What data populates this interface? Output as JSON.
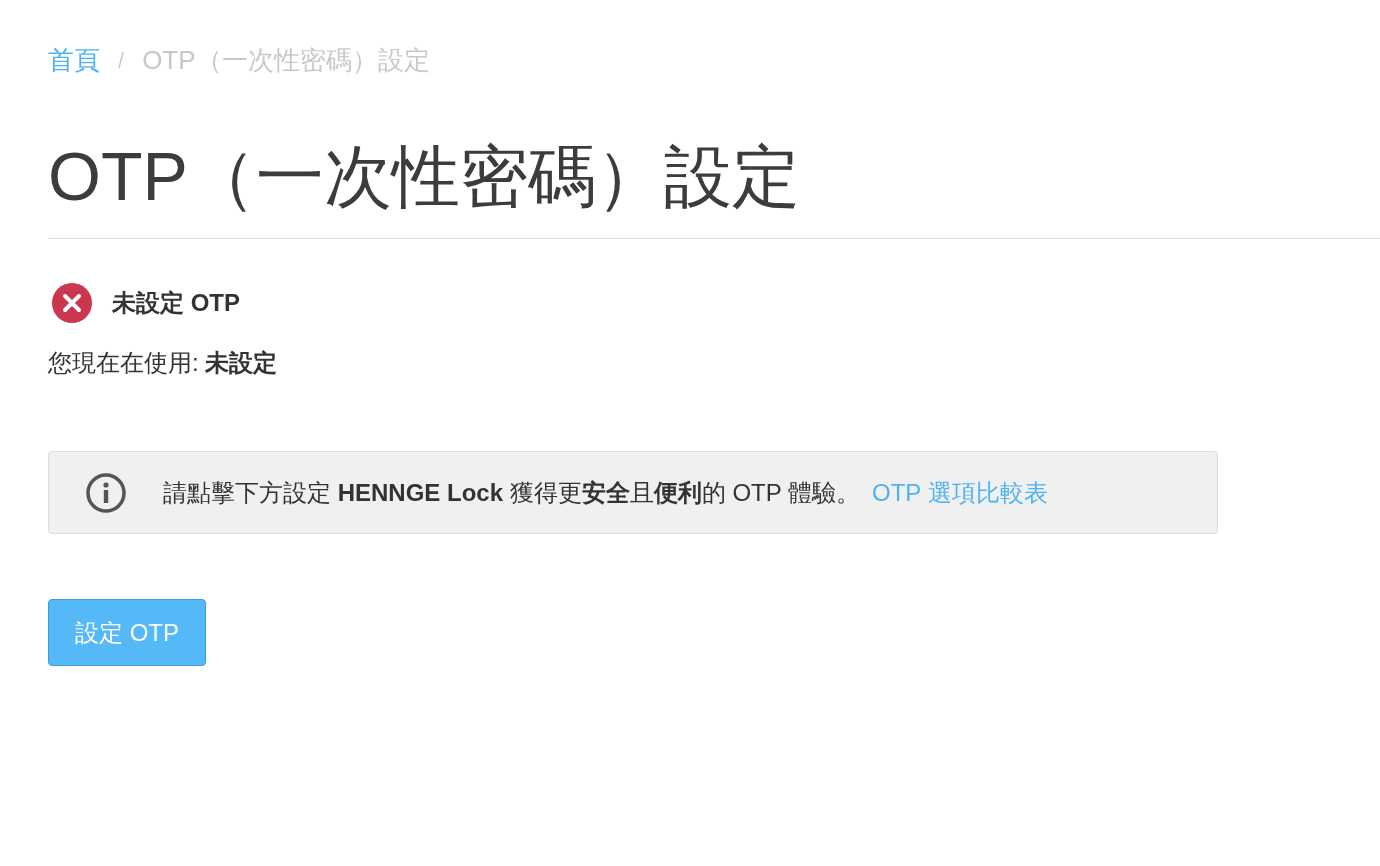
{
  "breadcrumb": {
    "separator": "/",
    "items": [
      {
        "label": "首頁",
        "kind": "link"
      },
      {
        "label": "OTP（一次性密碼）設定",
        "kind": "current"
      }
    ]
  },
  "title": "OTP（一次性密碼）設定",
  "status": {
    "kind": "error",
    "label": "未設定 OTP"
  },
  "current_usage": "您現在在使用: **未設定**",
  "notice": {
    "text": "請點擊下方設定 **HENNGE Lock** 獲得更**安全**且**便利**的 OTP 體驗。",
    "link": "OTP 選項比較表"
  },
  "button": "設定 OTP"
}
